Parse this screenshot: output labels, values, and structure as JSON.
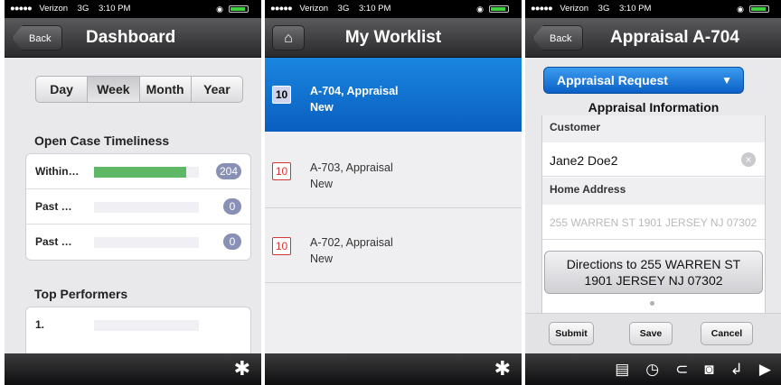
{
  "status": {
    "carrier": "Verizon",
    "network": "3G",
    "time": "3:10 PM"
  },
  "dashboard": {
    "title": "Dashboard",
    "back_label": "Back",
    "segments": [
      "Day",
      "Week",
      "Month",
      "Year"
    ],
    "selected_segment": "Week",
    "timeliness": {
      "heading": "Open Case Timeliness",
      "rows": [
        {
          "label": "Within…",
          "count": "204",
          "fill": 0.88
        },
        {
          "label": "Past …",
          "count": "0",
          "fill": 0
        },
        {
          "label": "Past …",
          "count": "0",
          "fill": 0
        }
      ]
    },
    "performers": {
      "heading": "Top Performers",
      "rows": [
        "1."
      ]
    }
  },
  "worklist": {
    "title": "My Worklist",
    "home_icon": "home-icon",
    "items": [
      {
        "badge": "10",
        "title": "A-704, Appraisal",
        "status": "New",
        "selected": true
      },
      {
        "badge": "10",
        "title": "A-703, Appraisal",
        "status": "New",
        "selected": false
      },
      {
        "badge": "10",
        "title": "A-702, Appraisal",
        "status": "New",
        "selected": false
      }
    ]
  },
  "appraisal": {
    "title": "Appraisal A-704",
    "back_label": "Back",
    "request_select": "Appraisal Request",
    "section_title": "Appraisal Information",
    "customer_label": "Customer",
    "customer_value": "Jane2 Doe2",
    "address_label": "Home Address",
    "address_value": "255 WARREN ST 1901 JERSEY NJ 07302",
    "directions_line1": "Directions to 255 WARREN ST",
    "directions_line2": "1901 JERSEY NJ 07302",
    "actions": {
      "submit": "Submit",
      "save": "Save",
      "cancel": "Cancel"
    },
    "toolbar_icons": [
      "document-icon",
      "history-icon",
      "attachment-icon",
      "camera-icon",
      "back-arrow-icon",
      "play-icon"
    ]
  },
  "colors": {
    "accent": "#0c60c6",
    "progress": "#5fb865",
    "badge": "#8890b5"
  }
}
